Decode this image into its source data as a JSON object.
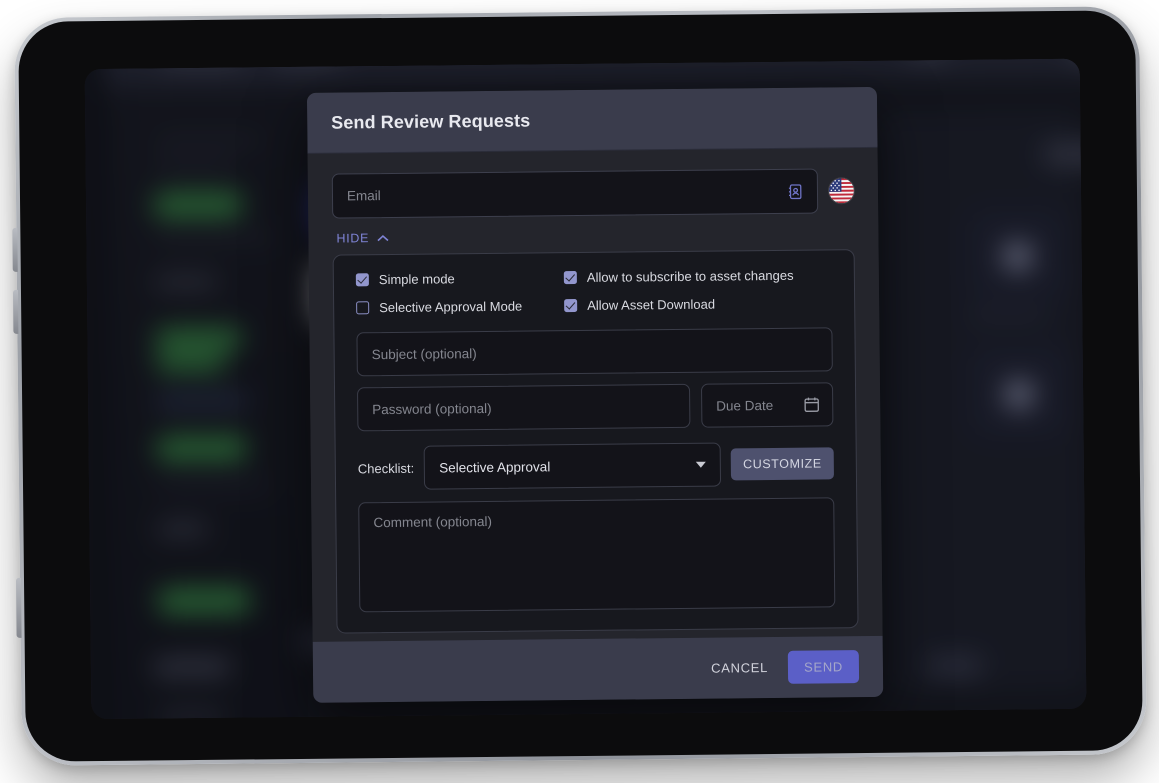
{
  "device": {
    "type": "tablet-mockup"
  },
  "dialog": {
    "title": "Send Review Requests",
    "email": {
      "placeholder": "Email",
      "value": "",
      "contacts_icon": "address-book-icon",
      "flag": "us-flag-icon"
    },
    "toggle": {
      "label": "HIDE",
      "chevron": "chevron-up-icon"
    },
    "checkboxes": [
      {
        "label": "Simple mode",
        "checked": true
      },
      {
        "label": "Allow to subscribe to asset changes",
        "checked": true
      },
      {
        "label": "Selective Approval Mode",
        "checked": false
      },
      {
        "label": "Allow Asset Download",
        "checked": true
      }
    ],
    "subject": {
      "placeholder": "Subject (optional)",
      "value": ""
    },
    "password": {
      "placeholder": "Password (optional)",
      "value": ""
    },
    "due_date": {
      "placeholder": "Due Date",
      "value": "",
      "icon": "calendar-icon"
    },
    "checklist": {
      "label": "Checklist:",
      "selected": "Selective Approval",
      "options": [
        "Selective Approval"
      ],
      "caret": "chevron-down-icon",
      "customize_label": "CUSTOMIZE"
    },
    "comment": {
      "placeholder": "Comment (optional)",
      "value": ""
    },
    "footer": {
      "cancel_label": "CANCEL",
      "send_label": "SEND"
    }
  },
  "colors": {
    "header_bg": "#3a3c4c",
    "body_bg": "#24252c",
    "panel_bg": "#17181e",
    "field_bg": "#131319",
    "accent_link": "#7f84d6",
    "checkbox_on": "#9296cd",
    "customize_bg": "#4e516e",
    "send_bg": "#5b5fc7",
    "text_primary": "#d9dae1",
    "placeholder": "#84868f"
  }
}
